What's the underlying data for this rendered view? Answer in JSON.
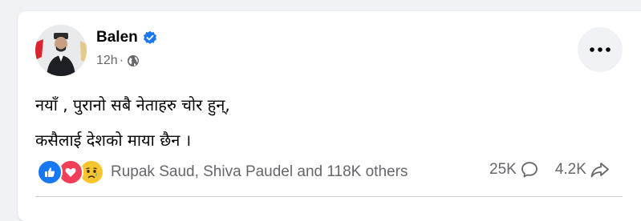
{
  "post": {
    "author": "Balen",
    "verified": true,
    "timestamp": "12h",
    "timestamp_separator": "·",
    "audience_icon": "globe-icon",
    "more_icon": "more-horizontal-icon",
    "text_lines": [
      "नयाँ , पुरानो सबै नेताहरु चोर हुन्,",
      "कसैलाई देशको माया छैन ।"
    ]
  },
  "reactions": {
    "icons": [
      "like-icon",
      "love-icon",
      "sad-icon"
    ],
    "summary": "Rupak Saud, Shiva Paudel and 118K others"
  },
  "stats": {
    "comments": "25K",
    "comments_icon": "comment-icon",
    "shares": "4.2K",
    "shares_icon": "share-icon"
  },
  "colors": {
    "background": "#f0f2f5",
    "card": "#ffffff",
    "primary_text": "#050505",
    "secondary_text": "#65676b",
    "verified_blue": "#1877f2",
    "like_blue": "#1877f2",
    "love_red": "#f33e58",
    "sad_yellow": "#f7c62f"
  }
}
